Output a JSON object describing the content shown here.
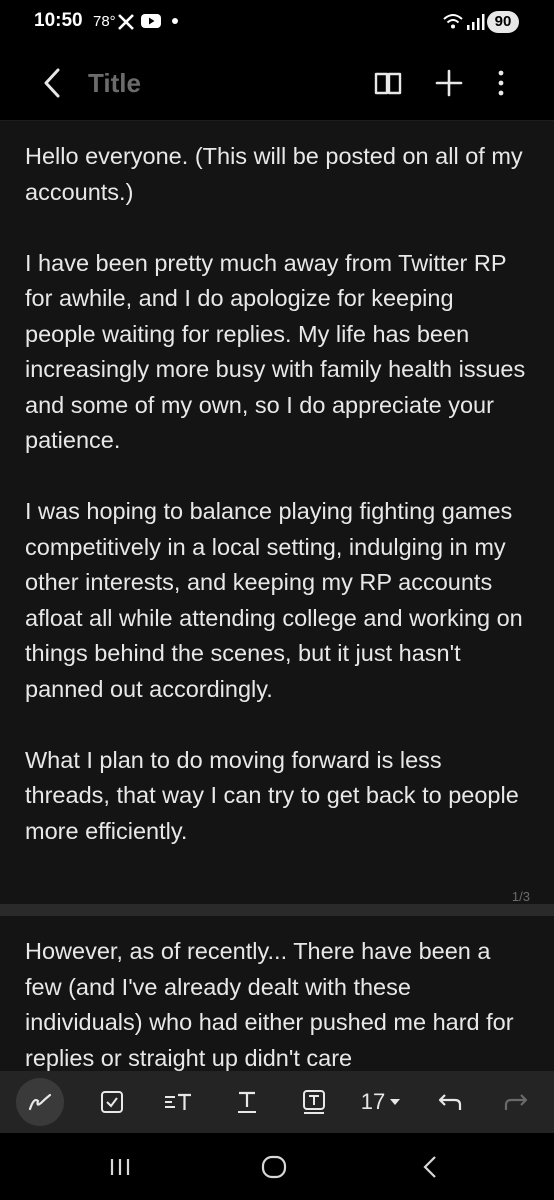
{
  "status": {
    "time": "10:50",
    "temp": "78°",
    "battery": "90",
    "icons": [
      "x-icon",
      "youtube-icon",
      "dot-icon",
      "wifi-icon",
      "signal-icon"
    ]
  },
  "toolbar": {
    "title": "Title",
    "icons": [
      "back-chevron-icon",
      "book-icon",
      "plus-icon",
      "more-vertical-icon"
    ]
  },
  "note": {
    "page1": {
      "paragraphs": [
        "Hello everyone. (This will be posted on all of my accounts.)",
        "I have been pretty much away from Twitter RP for awhile, and I do apologize for keeping people waiting for replies. My life has been increasingly more busy with family health issues and some of my own, so I do appreciate your patience.",
        "I was hoping to balance playing fighting games competitively in a local setting, indulging in my other interests, and keeping my RP accounts afloat all while attending college and working on things behind the scenes, but it just hasn't panned out accordingly.",
        "What I plan to do moving forward is less threads, that way I can try to get back to people more efficiently."
      ],
      "page_number": "1/3"
    },
    "page2": {
      "paragraphs": [
        "However, as of recently... There have been a few (and I've already dealt with these individuals) who had either pushed me hard for replies or straight up didn't care"
      ]
    }
  },
  "format_bar": {
    "font_size": "17",
    "icons": [
      "pen-icon",
      "checkbox-icon",
      "text-style-icon",
      "underline-text-icon",
      "text-box-icon",
      "dropdown-caret-icon",
      "undo-icon",
      "redo-icon"
    ]
  },
  "navbar": {
    "icons": [
      "recent-apps-icon",
      "home-icon",
      "back-icon"
    ]
  },
  "colors": {
    "background": "#000000",
    "page": "#141414",
    "text": "#e8e8e8",
    "title": "#6b6b6b",
    "format_bar": "#242424"
  }
}
